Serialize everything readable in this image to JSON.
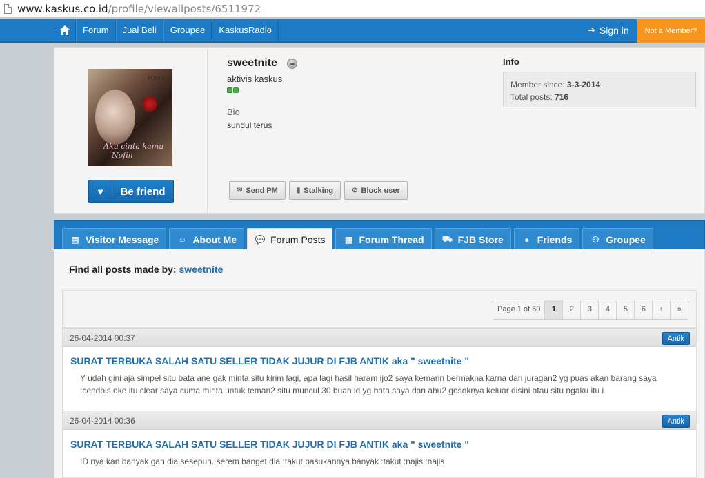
{
  "browser": {
    "url_main": "www.kaskus.co.id",
    "url_path": "/profile/viewallposts/6511972"
  },
  "topnav": {
    "items": [
      {
        "label": "Forum"
      },
      {
        "label": "Jual Beli"
      },
      {
        "label": "Groupee"
      },
      {
        "label": "KaskusRadio"
      }
    ],
    "signin": "Sign in",
    "not_member": "Not a Member?"
  },
  "profile": {
    "username": "sweetnite",
    "rank": "aktivis kaskus",
    "bio_label": "Bio",
    "bio_text": "sundul terus",
    "avatar_caption_line1": "Aku cinta kamu",
    "avatar_caption_line2": "Nofin",
    "befriend": "Be friend",
    "actions": [
      {
        "label": "Send PM",
        "icon": "envelope-icon"
      },
      {
        "label": "Stalking",
        "icon": "bookmark-icon"
      },
      {
        "label": "Block user",
        "icon": "eye-slash-icon"
      }
    ],
    "info_title": "Info",
    "member_since_label": "Member since:",
    "member_since_value": "3-3-2014",
    "total_posts_label": "Total posts:",
    "total_posts_value": "716"
  },
  "tabs": [
    {
      "label": "Visitor Message",
      "icon": "message-icon"
    },
    {
      "label": "About Me",
      "icon": "person-icon"
    },
    {
      "label": "Forum Posts",
      "icon": "speech-bubble-icon",
      "active": true
    },
    {
      "label": "Forum Thread",
      "icon": "thread-icon"
    },
    {
      "label": "FJB Store",
      "icon": "cart-icon"
    },
    {
      "label": "Friends",
      "icon": "friend-icon"
    },
    {
      "label": "Groupee",
      "icon": "group-icon"
    }
  ],
  "content": {
    "find_label": "Find all posts made by:",
    "find_user": "sweetnite",
    "pager": {
      "info": "Page 1 of 60",
      "pages": [
        "1",
        "2",
        "3",
        "4",
        "5",
        "6"
      ],
      "current": "1",
      "next": "›",
      "last": "»"
    },
    "posts": [
      {
        "date": "26-04-2014 00:37",
        "badge": "Antik",
        "title": "SURAT TERBUKA SALAH SATU SELLER TIDAK JUJUR DI FJB ANTIK aka \" sweetnite \"",
        "body": "Y udah gini aja simpel situ bata ane gak minta situ kirim lagi, apa lagi hasil haram ijo2 saya kemarin bermakna karna dari juragan2 yg puas akan barang saya :cendols oke itu clear saya cuma minta untuk teman2 situ muncul 30 buah id yg bata saya dan abu2 gosoknya keluar disini atau situ ngaku itu i"
      },
      {
        "date": "26-04-2014 00:36",
        "badge": "Antik",
        "title": "SURAT TERBUKA SALAH SATU SELLER TIDAK JUJUR DI FJB ANTIK aka \" sweetnite \"",
        "body": "ID nya kan banyak gan dia sesepuh. serem banget dia :takut pasukannya banyak :takut :najis :najis"
      }
    ]
  }
}
